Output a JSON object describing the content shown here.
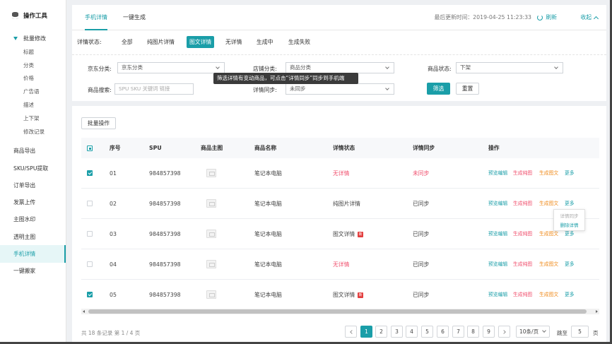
{
  "sidebar": {
    "header": "操作工具",
    "group": "批量修改",
    "sub_items": [
      "标题",
      "分类",
      "价格",
      "广告语",
      "描述",
      "上下架",
      "修改记录"
    ],
    "items": [
      "商品导出",
      "SKU/SPU提取",
      "订单导出",
      "发票上传",
      "主图水印",
      "透明主图",
      "手机详情",
      "一键搬家"
    ],
    "active_item": "手机详情"
  },
  "tabs": [
    "手机详情",
    "一键生成"
  ],
  "header": {
    "update_time": "最后更新时间：2019-04-25 11:23:33",
    "refresh_label": "刷新",
    "collapse_label": "收起"
  },
  "status_filter": {
    "label": "详情状态:",
    "options": [
      "全部",
      "纯图片详情",
      "图文详情",
      "无详情",
      "生成中",
      "生成失败"
    ],
    "selected": "图文详情"
  },
  "filters": {
    "jd_category_label": "京东分类:",
    "jd_category_value": "京东分类",
    "shop_category_label": "店铺分类:",
    "shop_category_value": "商品分类",
    "product_status_label": "商品状态:",
    "product_status_value": "下架",
    "search_label": "商品搜索:",
    "search_placeholder": "SPU SKU 关键词 链接",
    "sync_label": "详情同步:",
    "sync_value": "未同步",
    "filter_btn": "筛选",
    "reset_btn": "重置",
    "tooltip": "筛选详情有变动商品，可点击“详情同步”同步到手机端"
  },
  "batch_btn": "批量操作",
  "table": {
    "headers": [
      "序号",
      "SPU",
      "商品主图",
      "商品名称",
      "详情状态",
      "详情同步",
      "操作"
    ],
    "rows": [
      {
        "no": "01",
        "spu": "984857398",
        "name": "笔记本电脑",
        "status": "无详情",
        "sync": "未同步",
        "checked": true
      },
      {
        "no": "02",
        "spu": "984857398",
        "name": "笔记本电脑",
        "status": "纯图片详情",
        "sync": "已同步",
        "checked": false
      },
      {
        "no": "03",
        "spu": "984857398",
        "name": "笔记本电脑",
        "status": "图文详情",
        "sync": "已同步",
        "checked": false
      },
      {
        "no": "04",
        "spu": "984857398",
        "name": "笔记本电脑",
        "status": "无详情",
        "sync": "已同步",
        "checked": false
      },
      {
        "no": "05",
        "spu": "984857398",
        "name": "笔记本电脑",
        "status": "图文详情",
        "sync": "已同步",
        "checked": true
      }
    ],
    "ops": [
      "预览编辑",
      "生成纯图",
      "生成图文",
      "更多"
    ],
    "new_badge": "新"
  },
  "more_menu": [
    "详情同步",
    "删除详情"
  ],
  "pager": {
    "total": "共 18 条记录 第 1 / 4 页",
    "pages": [
      "1",
      "2",
      "3",
      "4",
      "5",
      "6",
      "7",
      "8",
      "9"
    ],
    "current": "1",
    "page_size": "10条/页",
    "jump_label": "跳至",
    "jump_value": "5",
    "jump_unit": "页"
  },
  "colors": {
    "accent": "#1a9ea8",
    "danger": "#f0506e",
    "warning": "#f08c1e"
  }
}
